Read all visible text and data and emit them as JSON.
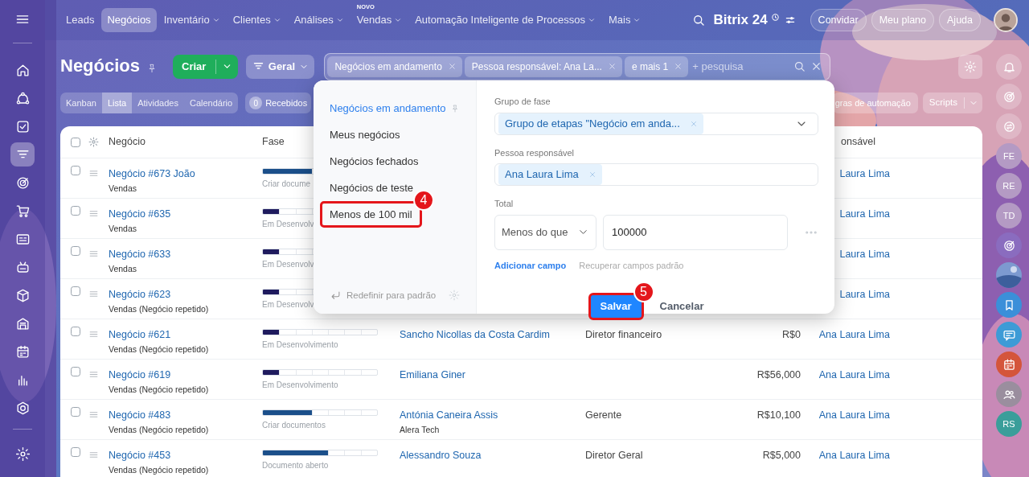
{
  "topbar": {
    "menu": [
      {
        "label": "Leads",
        "selected": false,
        "has_menu": false
      },
      {
        "label": "Negócios",
        "selected": true,
        "has_menu": false
      },
      {
        "label": "Inventário",
        "selected": false,
        "has_menu": true
      },
      {
        "label": "Clientes",
        "selected": false,
        "has_menu": true
      },
      {
        "label": "Análises",
        "selected": false,
        "has_menu": true
      },
      {
        "label": "Vendas",
        "selected": false,
        "has_menu": true,
        "badge": "NOVO"
      },
      {
        "label": "Automação Inteligente de Processos",
        "selected": false,
        "has_menu": true
      },
      {
        "label": "Mais",
        "selected": false,
        "has_menu": true
      }
    ],
    "logo": "Bitrix 24",
    "buttons": [
      "Convidar",
      "Meu plano",
      "Ajuda"
    ]
  },
  "sidebar": {
    "items": [
      {
        "selected": false
      },
      {
        "selected": false
      },
      {
        "selected": false
      },
      {
        "selected": true
      },
      {
        "selected": false
      },
      {
        "selected": false
      },
      {
        "selected": false
      },
      {
        "selected": false
      },
      {
        "selected": false
      },
      {
        "selected": false
      },
      {
        "selected": false
      },
      {
        "selected": false
      },
      {
        "selected": false
      }
    ]
  },
  "page": {
    "title": "Negócios",
    "create_button": "Criar",
    "category_button": "Geral"
  },
  "filter": {
    "chips": [
      "Negócios em andamento",
      "Pessoa responsável: Ana La...",
      "e mais 1"
    ],
    "placeholder": "+ pesquisa"
  },
  "views": [
    {
      "label": "Kanban",
      "selected": false
    },
    {
      "label": "Lista",
      "selected": true
    },
    {
      "label": "Atividades",
      "selected": false
    },
    {
      "label": "Calendário",
      "selected": false
    }
  ],
  "counter": {
    "count": "0",
    "label": "Recebidos"
  },
  "automation_button": "gras de automação",
  "scripts_button": "Scripts",
  "table": {
    "all_checked": false,
    "columns": [
      "Negócio",
      "Fase",
      "onsável"
    ],
    "rows": [
      {
        "checked": false,
        "title": "Negócio #673 João",
        "subtitle": "Vendas",
        "stage": {
          "label": "Criar docume",
          "level": 0.43,
          "color": "#1b4f8a"
        },
        "responsible": "Laura Lima"
      },
      {
        "checked": false,
        "title": "Negócio #635",
        "subtitle": "Vendas",
        "stage": {
          "label": "Em Desenvolv",
          "level": 0.14,
          "color": "#1f1b5e"
        },
        "responsible": "Laura Lima"
      },
      {
        "checked": false,
        "title": "Negócio #633",
        "subtitle": "Vendas",
        "stage": {
          "label": "Em Desenvolv",
          "level": 0.14,
          "color": "#1f1b5e"
        },
        "responsible": "Laura Lima"
      },
      {
        "checked": false,
        "title": "Negócio #623",
        "subtitle": "Vendas (Negócio repetido)",
        "stage": {
          "label": "Em Desenvolv",
          "level": 0.14,
          "color": "#1f1b5e"
        },
        "responsible": "Laura Lima"
      },
      {
        "checked": false,
        "title": "Negócio #621",
        "subtitle": "Vendas (Negócio repetido)",
        "stage": {
          "label": "Em Desenvolvimento",
          "level": 0.14,
          "color": "#1f1b5e"
        },
        "contact": "Sancho Nicollas da Costa Cardim",
        "position": "Diretor financeiro",
        "total": "R$0",
        "responsible": "Ana Laura Lima"
      },
      {
        "checked": false,
        "title": "Negócio #619",
        "subtitle": "Vendas (Negócio repetido)",
        "stage": {
          "label": "Em Desenvolvimento",
          "level": 0.14,
          "color": "#1f1b5e"
        },
        "contact": "Emiliana Giner",
        "total": "R$56,000",
        "responsible": "Ana Laura Lima"
      },
      {
        "checked": false,
        "title": "Negócio #483",
        "subtitle": "Vendas (Negócio repetido)",
        "stage": {
          "label": "Criar documentos",
          "level": 0.43,
          "color": "#1b4f8a"
        },
        "contact": "Antónia Caneira Assis",
        "company": "Alera Tech",
        "position": "Gerente",
        "total": "R$10,100",
        "responsible": "Ana Laura Lima"
      },
      {
        "checked": false,
        "title": "Negócio #453",
        "subtitle": "Vendas (Negócio repetido)",
        "stage": {
          "label": "Documento aberto",
          "level": 0.57,
          "color": "#1b4f8a"
        },
        "contact": "Alessandro Souza",
        "position": "Diretor Geral",
        "total": "R$5,000",
        "responsible": "Ana Laura Lima"
      }
    ]
  },
  "filter_popup": {
    "presets": [
      {
        "label": "Negócios em andamento",
        "selected": true,
        "pinned": true
      },
      {
        "label": "Meus negócios",
        "selected": false
      },
      {
        "label": "Negócios fechados",
        "selected": false
      },
      {
        "label": "Negócios de teste",
        "selected": false
      },
      {
        "label": "Menos de 100 mil",
        "selected": false,
        "callout": "4"
      }
    ],
    "reset": "Redefinir para padrão",
    "fields": [
      {
        "kind": "tags",
        "label": "Grupo de fase",
        "tags": [
          "Grupo de etapas \"Negócio em anda..."
        ]
      },
      {
        "kind": "tags",
        "label": "Pessoa responsável",
        "tags": [
          "Ana Laura Lima"
        ]
      },
      {
        "kind": "number",
        "label": "Total",
        "operator": "Menos do que",
        "value": "100000"
      }
    ],
    "add_field": "Adicionar campo",
    "restore_fields": "Recuperar campos padrão",
    "save": {
      "label": "Salvar",
      "callout": "5"
    },
    "cancel": "Cancelar"
  },
  "right_rail": [
    {
      "kind": "icon"
    },
    {
      "kind": "icon"
    },
    {
      "kind": "icon"
    },
    {
      "kind": "initials",
      "text": "FE",
      "color": "#b49ac4"
    },
    {
      "kind": "initials",
      "text": "RE",
      "color": "#b49ac4"
    },
    {
      "kind": "initials",
      "text": "TD",
      "color": "#b49ac4"
    },
    {
      "kind": "icon",
      "color": "#8a6cbf"
    },
    {
      "kind": "picture"
    },
    {
      "kind": "icon",
      "color": "#3b8fd9"
    },
    {
      "kind": "icon",
      "color": "#3d9bd6"
    },
    {
      "kind": "icon",
      "color": "#d4553b"
    },
    {
      "kind": "icon",
      "color": "#9a8e9e"
    },
    {
      "kind": "initials",
      "text": "RS",
      "color": "#3a9e9a"
    }
  ]
}
